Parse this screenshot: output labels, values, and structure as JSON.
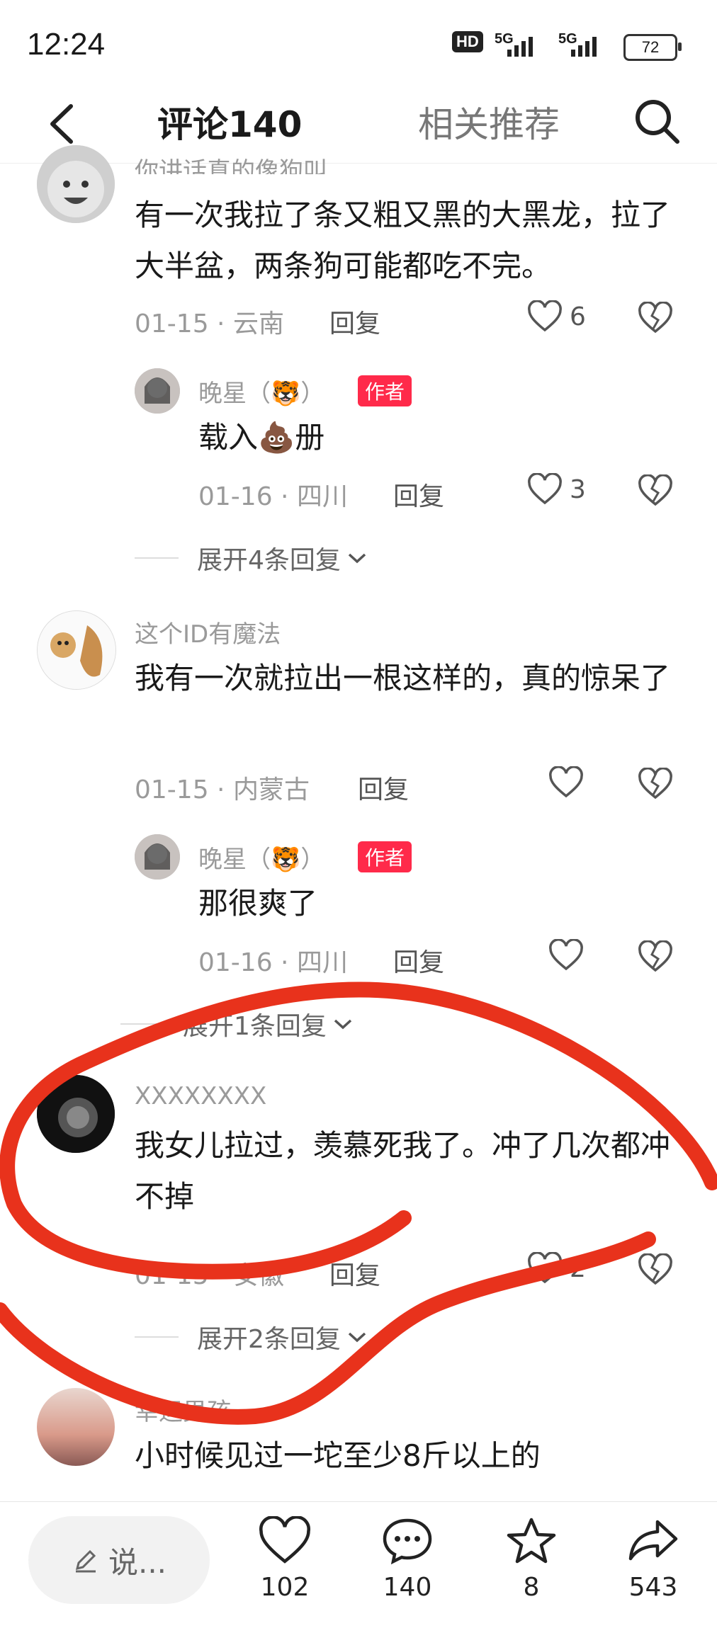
{
  "status": {
    "time": "12:24",
    "hd": "HD",
    "sig1": "5G",
    "sig2": "5G",
    "battery": "72"
  },
  "topnav": {
    "comments_tab": "评论140",
    "related_tab": "相关推荐"
  },
  "comments": [
    {
      "user": "你讲话真的像狗叫",
      "text": "有一次我拉了条又粗又黑的大黑龙，拉了大半盆，两条狗可能都吃不完。",
      "meta": "01-15 · 云南",
      "reply_label": "回复",
      "likes": "6",
      "sub": {
        "user": "晚星（🐯）",
        "badge": "作者",
        "text": "载入💩册",
        "meta": "01-16 · 四川",
        "reply_label": "回复",
        "likes": "3"
      },
      "expand": "展开4条回复"
    },
    {
      "user": "这个ID有魔法",
      "text": "我有一次就拉出一根这样的，真的惊呆了",
      "meta": "01-15 · 内蒙古",
      "reply_label": "回复",
      "likes": "",
      "sub": {
        "user": "晚星（🐯）",
        "badge": "作者",
        "text": "那很爽了",
        "meta": "01-16 · 四川",
        "reply_label": "回复",
        "likes": ""
      },
      "expand": "展开1条回复"
    },
    {
      "user": "XXXXXXXX",
      "text": "我女儿拉过，羡慕死我了。冲了几次都冲不掉",
      "meta": "01-15 · 安徽",
      "reply_label": "回复",
      "likes": "2",
      "expand": "展开2条回复"
    },
    {
      "user": "幸运男孩",
      "text": "小时候见过一坨至少8斤以上的"
    }
  ],
  "bottombar": {
    "say_placeholder": "说...",
    "likes": "102",
    "comments": "140",
    "favorites": "8",
    "shares": "543"
  },
  "colors": {
    "accent": "#ff2a4a",
    "annotation": "#e8321c"
  }
}
